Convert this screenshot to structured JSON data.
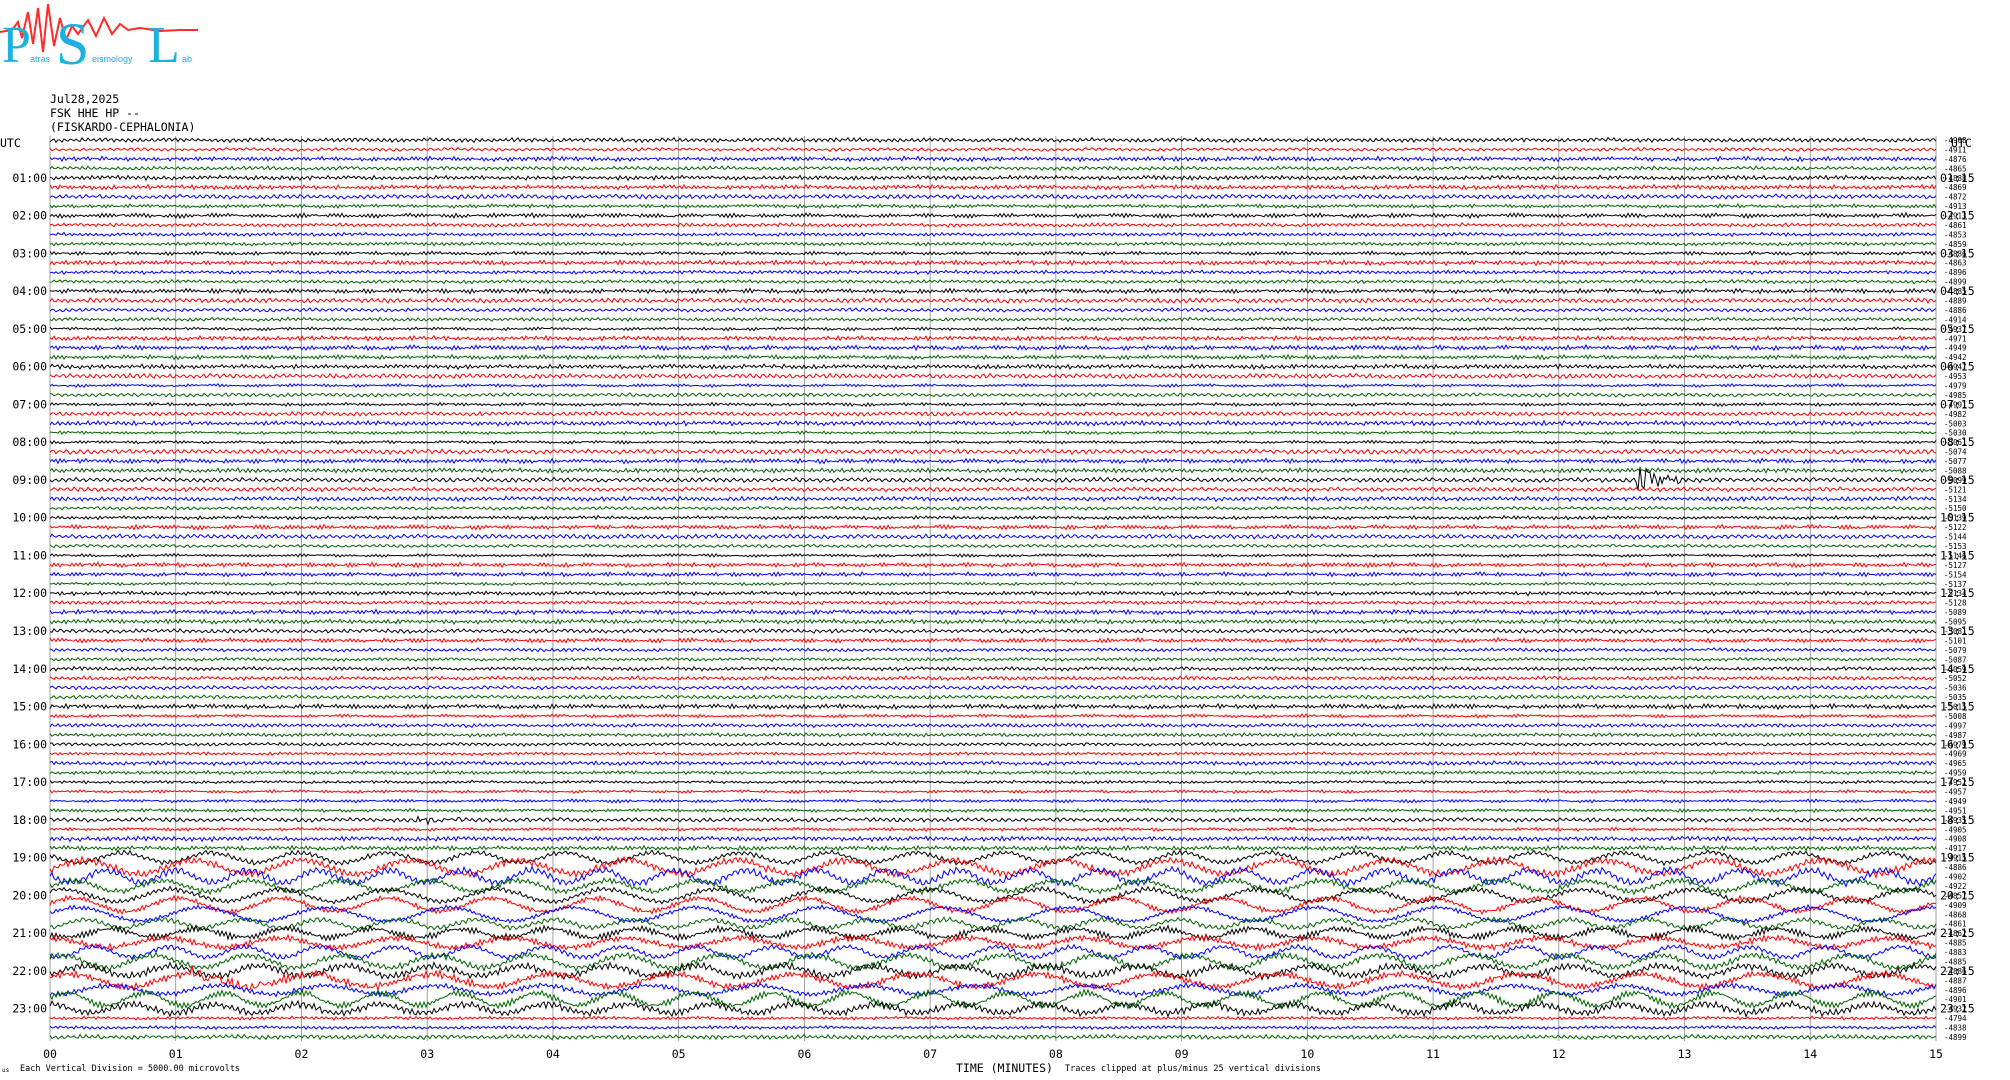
{
  "logo": {
    "letters": [
      "P",
      "S",
      "L"
    ],
    "subtext": [
      "atras",
      "eismology",
      "ab"
    ],
    "colors": {
      "letters": "#1ab0e0",
      "wave": "#ff2a2a"
    }
  },
  "header": {
    "date": "Jul28,2025",
    "station": "FSK HHE HP --",
    "location": "(FISKARDO-CEPHALONIA)"
  },
  "utc_label": "UTC",
  "footer": {
    "division": "Each Vertical Division = 5000.00 microvolts",
    "xlabel": "TIME (MINUTES)",
    "clip": "Traces clipped at plus/minus 25 vertical divisions",
    "corner": "us"
  },
  "chart_data": {
    "type": "line",
    "title": "FSK HHE HP -- (FISKARDO-CEPHALONIA) Jul28,2025",
    "xlabel": "TIME (MINUTES)",
    "x_ticks": [
      "00",
      "01",
      "02",
      "03",
      "04",
      "05",
      "06",
      "07",
      "08",
      "09",
      "10",
      "11",
      "12",
      "13",
      "14",
      "15"
    ],
    "xlim": [
      0,
      15
    ],
    "grid": "vertical",
    "trace_colors": [
      "#000000",
      "#ff0000",
      "#0000ff",
      "#006400"
    ],
    "hour_labels_left": [
      "01:00",
      "02:00",
      "03:00",
      "04:00",
      "05:00",
      "06:00",
      "07:00",
      "08:00",
      "09:00",
      "10:00",
      "11:00",
      "12:00",
      "13:00",
      "14:00",
      "15:00",
      "16:00",
      "17:00",
      "18:00",
      "19:00",
      "20:00",
      "21:00",
      "22:00",
      "23:00"
    ],
    "hour_labels_right": [
      "01:15",
      "02:15",
      "03:15",
      "04:15",
      "05:15",
      "06:15",
      "07:15",
      "08:15",
      "09:15",
      "10:15",
      "11:15",
      "12:15",
      "13:15",
      "14:15",
      "15:15",
      "16:15",
      "17:15",
      "18:15",
      "19:15",
      "20:15",
      "21:15",
      "22:15",
      "23:15"
    ],
    "trace_offsets": [
      -4908,
      -4911,
      -4876,
      -4865,
      -4888,
      -4869,
      -4872,
      -4913,
      -4913,
      -4861,
      -4853,
      -4859,
      -4886,
      -4863,
      -4896,
      -4899,
      -4885,
      -4889,
      -4886,
      -4914,
      -4937,
      -4971,
      -4949,
      -4942,
      -4947,
      -4953,
      -4979,
      -4985,
      -4991,
      -4982,
      -5003,
      -5030,
      -5061,
      -5074,
      -5077,
      -5088,
      -5099,
      -5121,
      -5134,
      -5150,
      -5139,
      -5122,
      -5144,
      -5153,
      -5146,
      -5127,
      -5154,
      -5137,
      -5134,
      -5128,
      -5089,
      -5095,
      -5081,
      -5101,
      -5079,
      -5087,
      -5059,
      -5052,
      -5036,
      -5035,
      -5015,
      -5008,
      -4997,
      -4987,
      -4979,
      -4969,
      -4965,
      -4959,
      -4952,
      -4957,
      -4949,
      -4951,
      -4935,
      -4905,
      -4908,
      -4917,
      -4915,
      -4886,
      -4902,
      -4922,
      -4857,
      -4909,
      -4868,
      -4861,
      -4862,
      -4885,
      -4883,
      -4885,
      -4886,
      -4887,
      -4896,
      -4901,
      -4932,
      -4794,
      -4838,
      -4899
    ],
    "events": [
      {
        "trace": 36,
        "minute": 12.6,
        "amplitude": "large",
        "duration_min": 0.6
      },
      {
        "trace": 89,
        "minute": 1.1,
        "amplitude": "medium",
        "duration_min": 3.0
      },
      {
        "trace": 72,
        "minute": 2.9,
        "amplitude": "small",
        "duration_min": 1.2
      }
    ]
  }
}
